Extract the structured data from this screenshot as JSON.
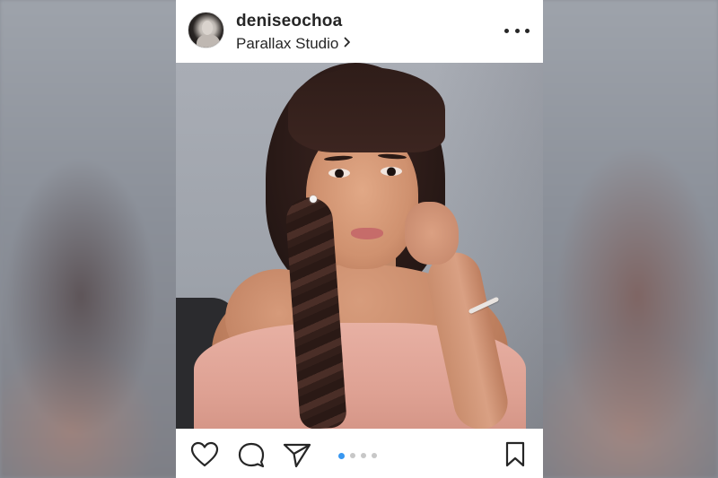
{
  "post": {
    "username": "deniseochoa",
    "location": "Parallax Studio",
    "carousel": {
      "total": 4,
      "active_index": 0
    }
  },
  "icons": {
    "more": "more-options-icon",
    "location_chevron": "chevron-right-icon",
    "like": "heart-icon",
    "comment": "comment-bubble-icon",
    "share": "paper-plane-icon",
    "save": "bookmark-icon"
  },
  "colors": {
    "text": "#262626",
    "active_dot": "#3897f0",
    "inactive_dot": "#c7c7c7"
  }
}
